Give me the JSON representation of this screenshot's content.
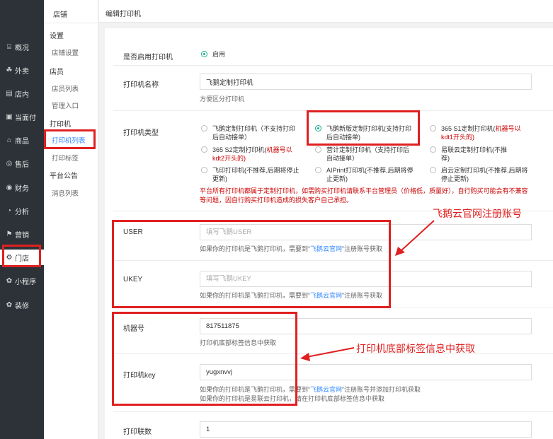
{
  "nav": {
    "items": [
      {
        "label": "概况",
        "icon": "overview-icon"
      },
      {
        "label": "外卖",
        "icon": "takeout-icon"
      },
      {
        "label": "店内",
        "icon": "instore-icon"
      },
      {
        "label": "当面付",
        "icon": "pay-icon"
      },
      {
        "label": "商品",
        "icon": "goods-icon"
      },
      {
        "label": "售后",
        "icon": "aftersale-icon"
      },
      {
        "label": "财务",
        "icon": "finance-icon"
      },
      {
        "label": "分析",
        "icon": "analysis-icon"
      },
      {
        "label": "营销",
        "icon": "marketing-icon"
      },
      {
        "label": "门店",
        "icon": "store-icon"
      },
      {
        "label": "小程序",
        "icon": "miniapp-icon"
      },
      {
        "label": "装修",
        "icon": "decorate-icon"
      }
    ]
  },
  "subnav": {
    "header": "店铺",
    "g1": "设置",
    "l1": "店铺设置",
    "g2": "店员",
    "l2": "店员列表",
    "l3": "管理入口",
    "g3": "打印机",
    "l4": "打印机列表",
    "l5": "打印标签",
    "g4": "平台公告",
    "l6": "消息列表"
  },
  "header": {
    "title": "编辑打印机"
  },
  "form": {
    "enable": {
      "label": "是否启用打印机",
      "option": "启用"
    },
    "name": {
      "label": "打印机名称",
      "value": "飞鹅定制打印机",
      "help": "方便区分打印机"
    },
    "type": {
      "label": "打印机类型",
      "options": [
        {
          "a": "飞鹅定制打印机（不支持打印",
          "b": "后自动接单）",
          "r": ""
        },
        {
          "a": "飞鹅新版定制打印机(支持打印",
          "b": "后自动接单)",
          "r": ""
        },
        {
          "a": "365 S1定制打印机(",
          "r": "机器号以",
          "b": "",
          "rb": "kdt1开头的)"
        },
        {
          "a": "365 S2定制打印机(",
          "r": "机器号以",
          "b": "",
          "rb": "kdt2开头的)"
        },
        {
          "a": "营计定制打印机（支持打印后",
          "b": "自动接单）",
          "r": ""
        },
        {
          "a": "易联云定制打印机(不推",
          "b": "荐)",
          "r": ""
        },
        {
          "a": "飞印打印机(不推荐,后期将停止",
          "b": "更新)",
          "r": ""
        },
        {
          "a": "AIPrint打印机(不推荐,后期将停",
          "b": "止更新)",
          "r": ""
        },
        {
          "a": "启云定制打印机(不推荐,后期将",
          "b": "停止更新)",
          "r": ""
        }
      ],
      "warning": "平台所有打印机都属于定制打印机，如需购买打印机请联系平台管理员（价格低，质量好），自行购买可能会有不兼容等问题，因自行购买打印机造成的损失客户自己承担。"
    },
    "user": {
      "label": "USER",
      "placeholder": "填写飞鹅USER",
      "help_a": "如果你的打印机是飞鹅打印机，需要到“",
      "help_link": "飞鹅云官网",
      "help_b": "”注册账号获取"
    },
    "ukey": {
      "label": "UKEY",
      "placeholder": "填写飞鹅UKEY",
      "help_a": "如果你的打印机是飞鹅打印机，需要到“",
      "help_link": "飞鹅云官网",
      "help_b": "”注册账号获取"
    },
    "machine": {
      "label": "机器号",
      "value": "817511875",
      "help": "打印机底部标签信息中获取"
    },
    "key": {
      "label": "打印机key",
      "value": "yugxnvvj",
      "help1_a": "如果你的打印机是飞鹅打印机，需要到“",
      "help1_link": "飞鹅云官网",
      "help1_b": "”注册账号并添加打印机获取",
      "help2": "如果你的打印机是易联云打印机，请在打印机底部标签信息中获取"
    },
    "copies": {
      "label": "打印联数",
      "value": "1"
    }
  },
  "annotations": {
    "top": "飞鹅云官网注册账号",
    "bottom": "打印机底部标签信息中获取"
  },
  "colors": {
    "highlight": "#e02020",
    "accent": "#38f",
    "radio": "#1aad8d",
    "nav_bg": "#2c3238"
  }
}
